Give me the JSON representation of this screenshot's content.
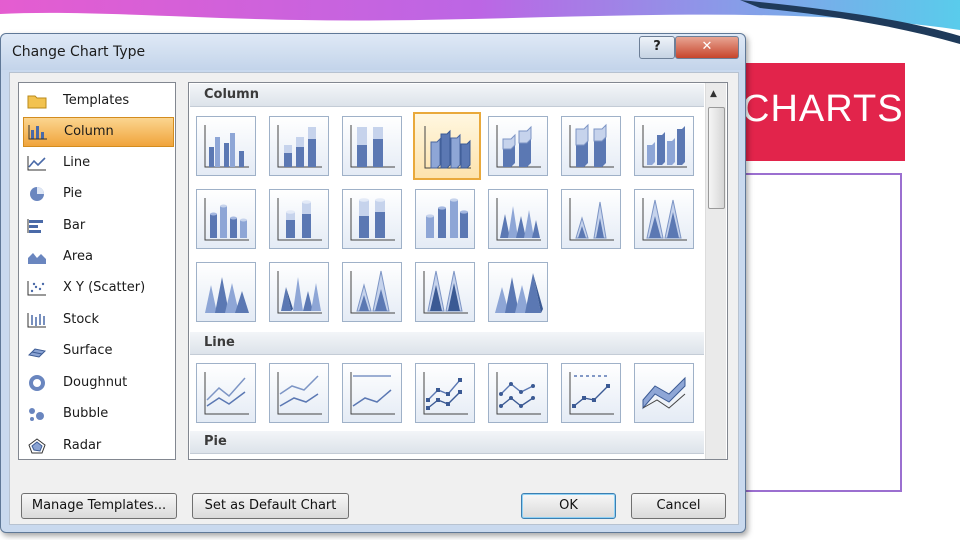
{
  "slide": {
    "title": "CHARTS",
    "accent_color": "#e2244b",
    "content_border_color": "#9b6fd0"
  },
  "dialog": {
    "title": "Change Chart Type",
    "help_label": "?",
    "close_label": "✕",
    "categories": [
      {
        "label": "Templates",
        "icon": "folder-icon"
      },
      {
        "label": "Column",
        "icon": "column-chart-icon",
        "selected": true
      },
      {
        "label": "Line",
        "icon": "line-chart-icon"
      },
      {
        "label": "Pie",
        "icon": "pie-chart-icon"
      },
      {
        "label": "Bar",
        "icon": "bar-chart-icon"
      },
      {
        "label": "Area",
        "icon": "area-chart-icon"
      },
      {
        "label": "X Y (Scatter)",
        "icon": "scatter-chart-icon"
      },
      {
        "label": "Stock",
        "icon": "stock-chart-icon"
      },
      {
        "label": "Surface",
        "icon": "surface-chart-icon"
      },
      {
        "label": "Doughnut",
        "icon": "doughnut-chart-icon"
      },
      {
        "label": "Bubble",
        "icon": "bubble-chart-icon"
      },
      {
        "label": "Radar",
        "icon": "radar-chart-icon"
      }
    ],
    "groups": {
      "column": "Column",
      "line": "Line",
      "pie": "Pie"
    },
    "buttons": {
      "manage_templates": "Manage Templates...",
      "set_default": "Set as Default Chart",
      "ok": "OK",
      "cancel": "Cancel"
    }
  }
}
